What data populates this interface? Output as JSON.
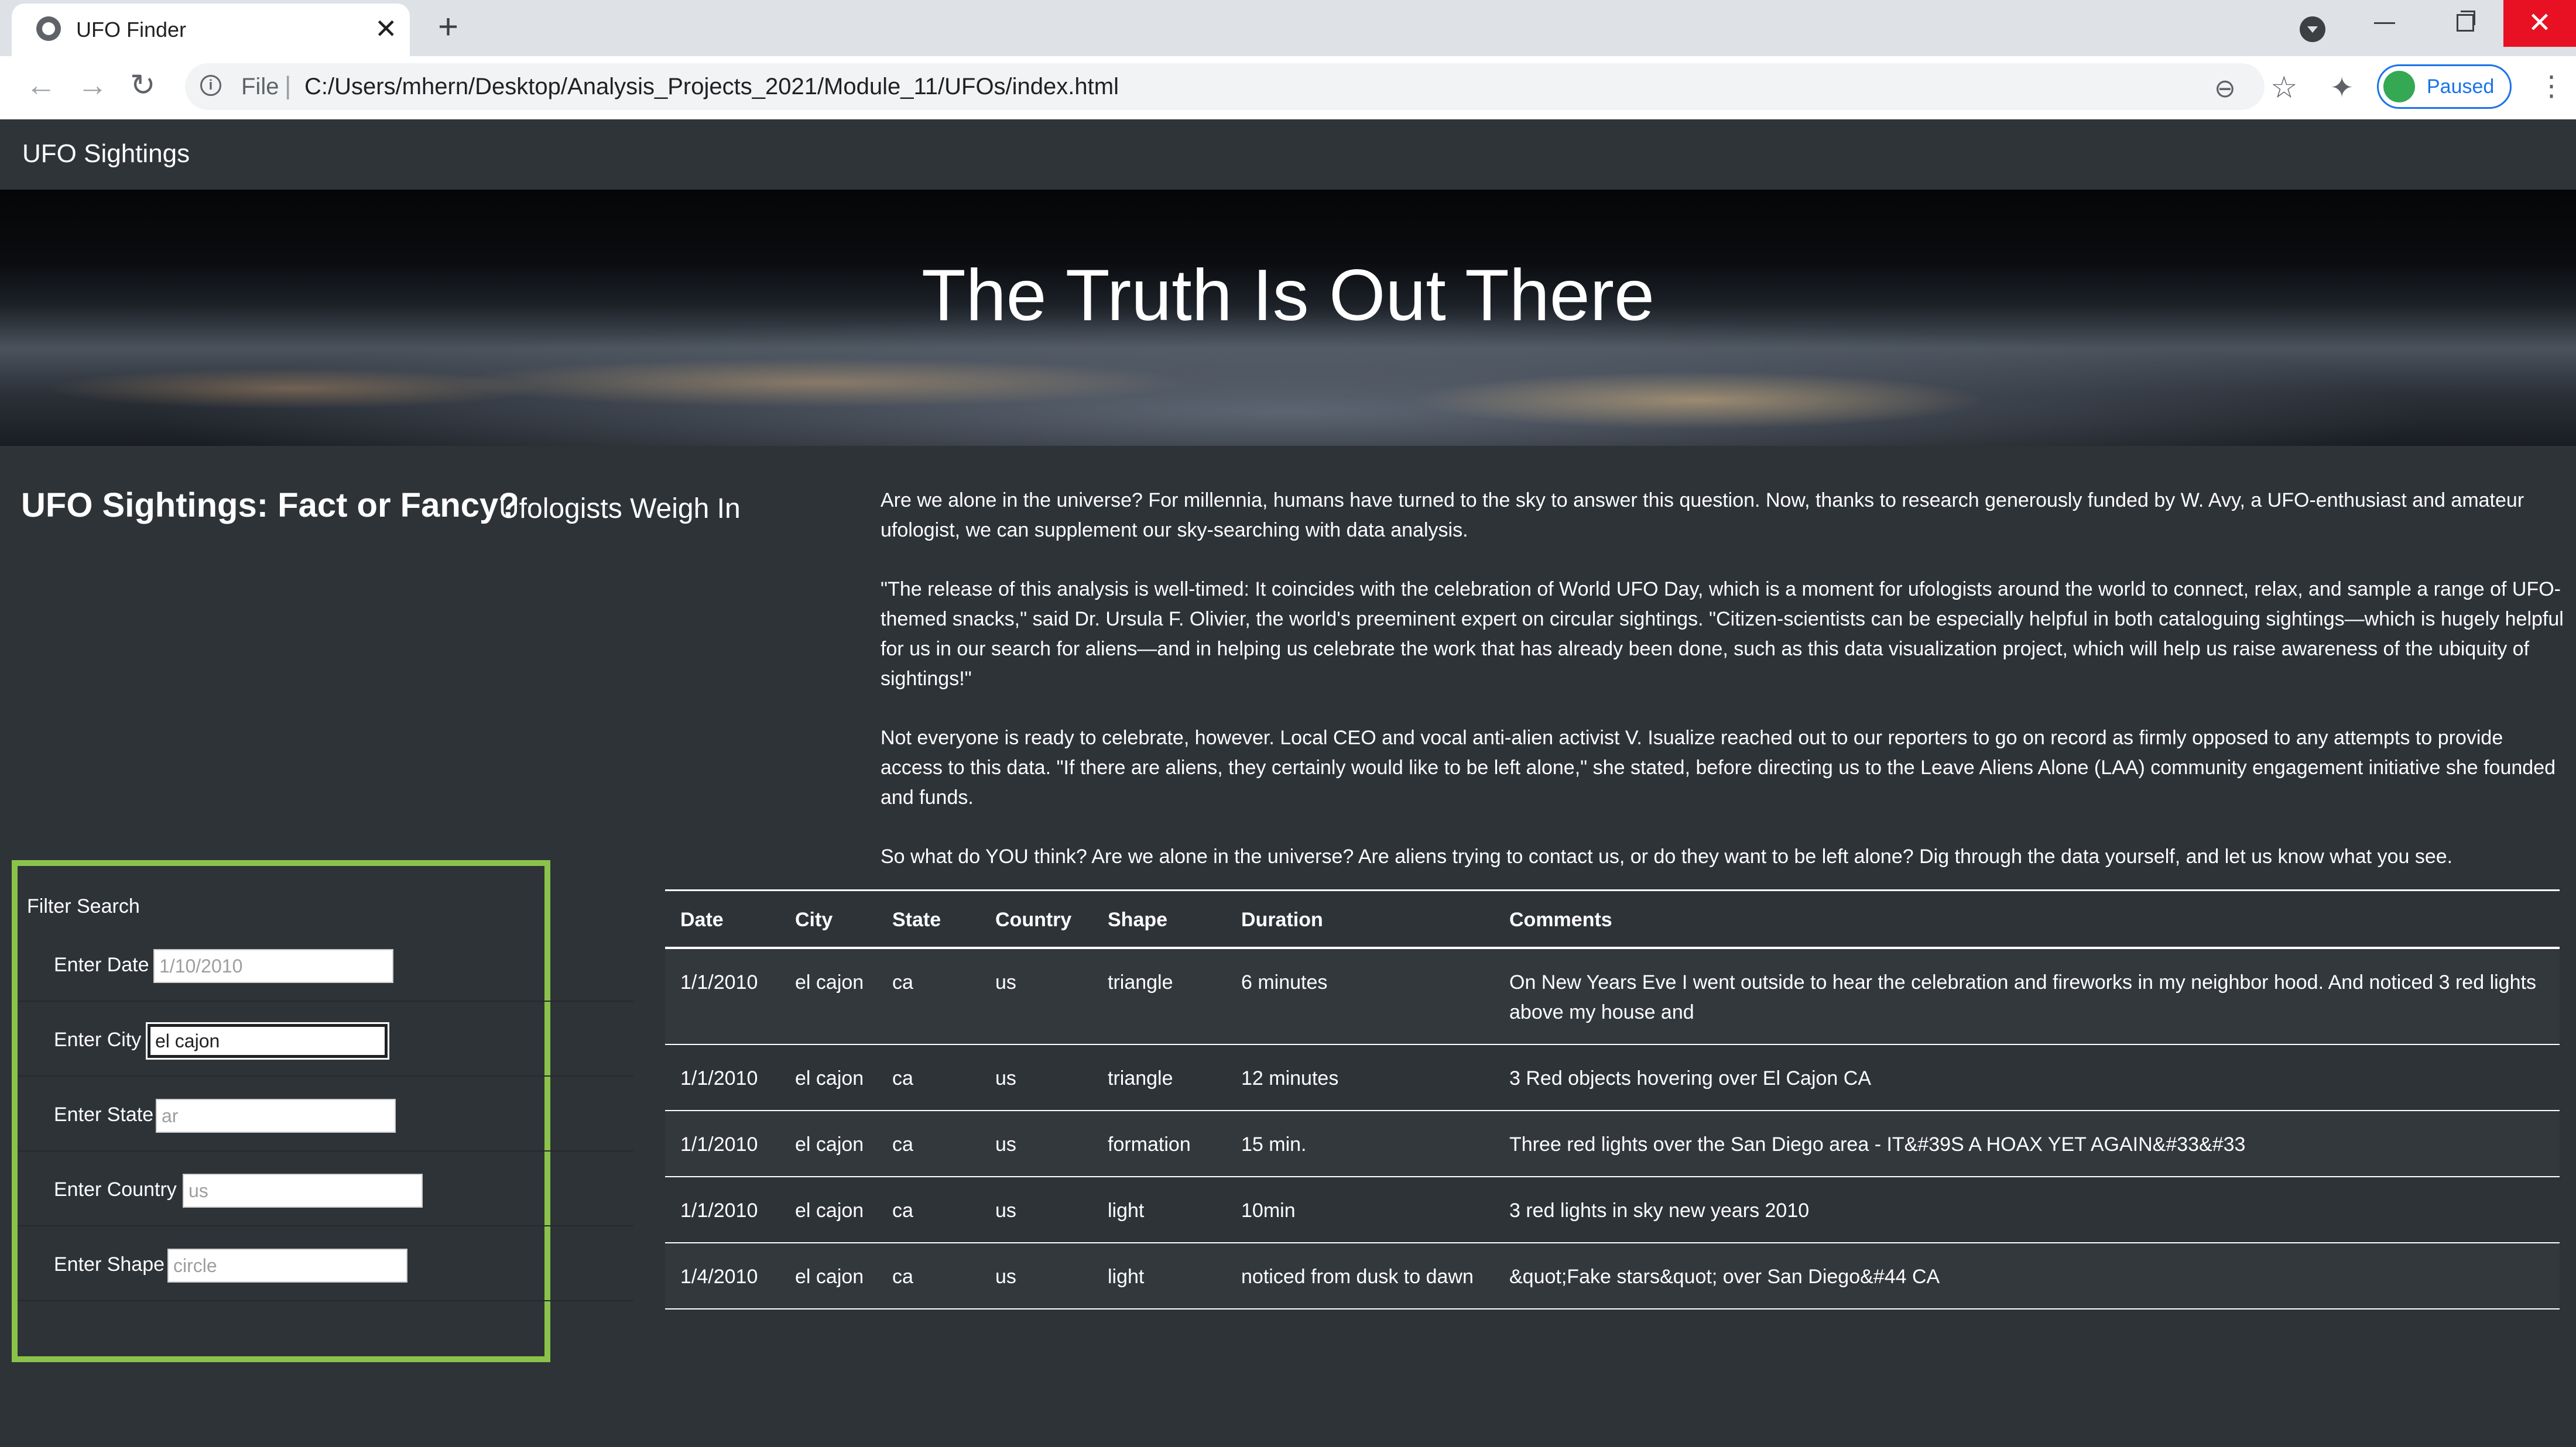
{
  "browser": {
    "tab_title": "UFO Finder",
    "tab_close": "✕",
    "new_tab": "+",
    "url_scheme": "File",
    "url_separator": "|",
    "url": "C:/Users/mhern/Desktop/Analysis_Projects_2021/Module_11/UFOs/index.html",
    "profile_status": "Paused",
    "window_close": "✕"
  },
  "navbar": {
    "brand": "UFO Sightings"
  },
  "hero": {
    "title": "The Truth Is Out There"
  },
  "article": {
    "title": "UFO Sightings: Fact or Fancy?",
    "subtitle": "Ufologists Weigh In",
    "paragraphs": [
      "Are we alone in the universe? For millennia, humans have turned to the sky to answer this question. Now, thanks to research generously funded by W. Avy, a UFO-enthusiast and amateur ufologist, we can supplement our sky-searching with data analysis.",
      "\"The release of this analysis is well-timed: It coincides with the celebration of World UFO Day, which is a moment for ufologists around the world to connect, relax, and sample a range of UFO-themed snacks,\" said Dr. Ursula F. Olivier, the world's preeminent expert on circular sightings. \"Citizen-scientists can be especially helpful in both cataloguing sightings—which is hugely helpful for us in our search for aliens—and in helping us celebrate the work that has already been done, such as this data visualization project, which will help us raise awareness of the ubiquity of sightings!\"",
      "Not everyone is ready to celebrate, however. Local CEO and vocal anti-alien activist V. Isualize reached out to our reporters to go on record as firmly opposed to any attempts to provide access to this data. \"If there are aliens, they certainly would like to be left alone,\" she stated, before directing us to the Leave Aliens Alone (LAA) community engagement initiative she founded and funds.",
      "So what do YOU think? Are we alone in the universe? Are aliens trying to contact us, or do they want to be left alone? Dig through the data yourself, and let us know what you see."
    ]
  },
  "filters": {
    "heading": "Filter Search",
    "date": {
      "label": "Enter Date",
      "placeholder": "1/10/2010",
      "value": ""
    },
    "city": {
      "label": "Enter City",
      "placeholder": "",
      "value": "el cajon"
    },
    "state": {
      "label": "Enter State",
      "placeholder": "ar",
      "value": ""
    },
    "country": {
      "label": "Enter Country",
      "placeholder": "us",
      "value": ""
    },
    "shape": {
      "label": "Enter Shape",
      "placeholder": "circle",
      "value": ""
    }
  },
  "table": {
    "headers": [
      "Date",
      "City",
      "State",
      "Country",
      "Shape",
      "Duration",
      "Comments"
    ],
    "rows": [
      [
        "1/1/2010",
        "el cajon",
        "ca",
        "us",
        "triangle",
        "6 minutes",
        "On New Years Eve I went outside to hear the celebration and fireworks in my neighbor hood. And noticed 3 red lights above my house and"
      ],
      [
        "1/1/2010",
        "el cajon",
        "ca",
        "us",
        "triangle",
        "12 minutes",
        "3 Red objects hovering over El Cajon CA"
      ],
      [
        "1/1/2010",
        "el cajon",
        "ca",
        "us",
        "formation",
        "15 min.",
        "Three red lights over the San Diego area - IT&#39S A HOAX YET AGAIN&#33&#33"
      ],
      [
        "1/1/2010",
        "el cajon",
        "ca",
        "us",
        "light",
        "10min",
        "3 red lights in sky new years 2010"
      ],
      [
        "1/4/2010",
        "el cajon",
        "ca",
        "us",
        "light",
        "noticed from dusk to dawn",
        "&quot;Fake stars&quot; over San Diego&#44 CA"
      ]
    ]
  }
}
